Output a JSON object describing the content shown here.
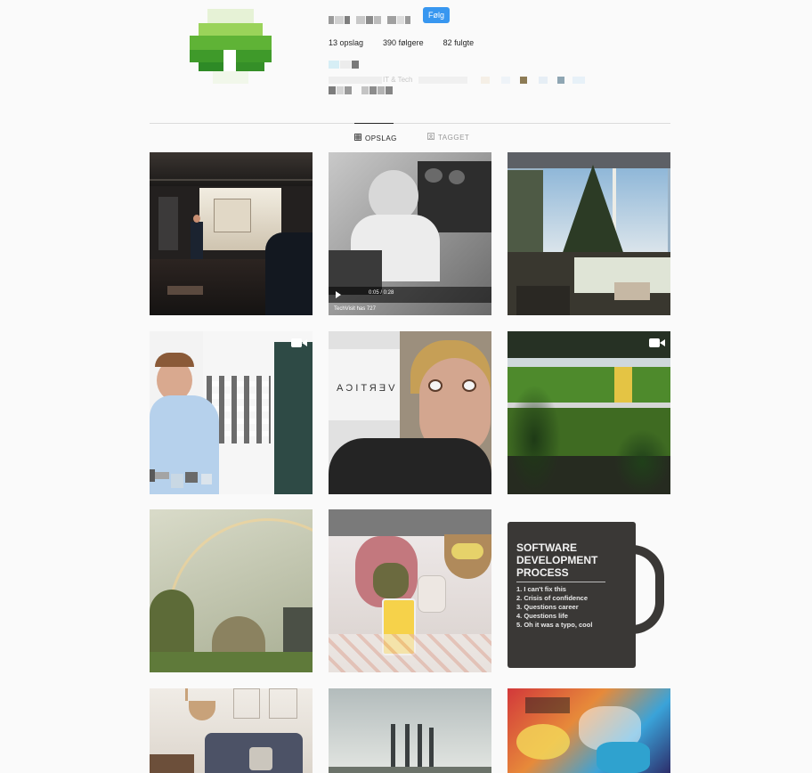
{
  "profile": {
    "follow_label": "Følg",
    "stats": {
      "posts": "13 opslag",
      "followers": "390 følgere",
      "following": "82 fulgte"
    },
    "bio_fragment": "IT & Tech",
    "accent_color": "#3897f0"
  },
  "tabs": [
    {
      "label": "OPSLAG",
      "icon": "grid-icon",
      "active": true
    },
    {
      "label": "TAGGET",
      "icon": "tag-icon",
      "active": false
    }
  ],
  "posts": [
    {
      "subject": "presentation-stage",
      "video": false
    },
    {
      "subject": "cockpit-bw",
      "video": false,
      "overlay_text": "TechVisit has 727",
      "player_time": "0:05 / 0:28"
    },
    {
      "subject": "christmas-tree-window",
      "video": false
    },
    {
      "subject": "man-space-invaders-wall",
      "video": true
    },
    {
      "subject": "selfie-vertica",
      "video": false,
      "wall_text": "VERTICA"
    },
    {
      "subject": "garden-lawn",
      "video": true
    },
    {
      "subject": "rainbow-trees",
      "video": false
    },
    {
      "subject": "breakfast-table",
      "video": false
    },
    {
      "subject": "software-mug",
      "video": false,
      "mug_title": [
        "SOFTWARE",
        "DEVELOPMENT",
        "PROCESS"
      ],
      "mug_list": [
        "1. I can't fix this",
        "2. Crisis of confidence",
        "3. Questions career",
        "4. Questions life",
        "5. Oh it was a typo, cool"
      ]
    },
    {
      "subject": "living-room-sofa",
      "video": false
    },
    {
      "subject": "chimneys",
      "video": false
    },
    {
      "subject": "graffiti-wall",
      "video": false
    }
  ]
}
